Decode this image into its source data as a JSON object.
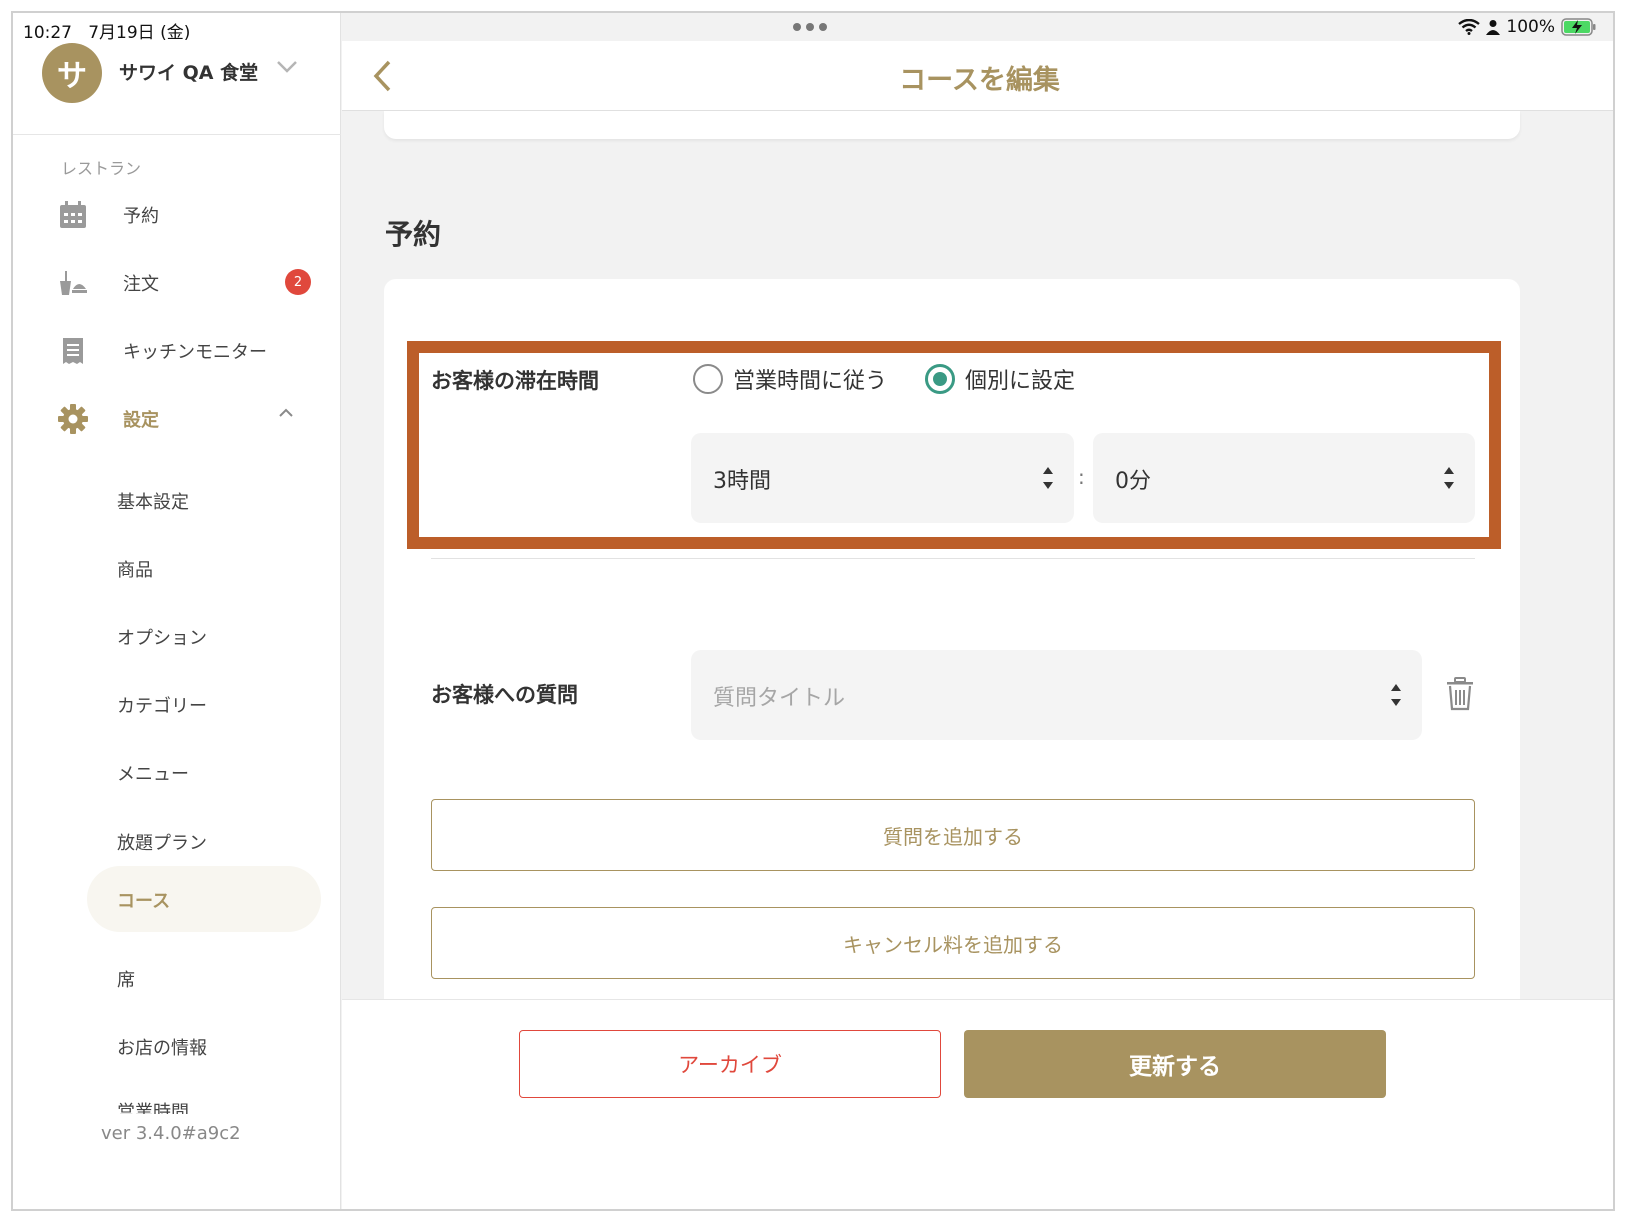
{
  "status_bar": {
    "time": "10:27",
    "date": "7月19日 (金)",
    "battery": "100%"
  },
  "sidebar": {
    "avatar_letter": "サ",
    "shop_name": "サワイ QA 食堂",
    "section_label": "レストラン",
    "nav": [
      {
        "label": "予約",
        "icon": "calendar-icon"
      },
      {
        "label": "注文",
        "icon": "order-icon",
        "badge": "2"
      },
      {
        "label": "キッチンモニター",
        "icon": "receipt-icon"
      },
      {
        "label": "設定",
        "icon": "gear-icon"
      }
    ],
    "settings_items": [
      "基本設定",
      "商品",
      "オプション",
      "カテゴリー",
      "メニュー",
      "放題プラン",
      "コース",
      "席",
      "お店の情報",
      "営業時間"
    ],
    "active_item": "コース",
    "version": "ver 3.4.0#a9c2"
  },
  "header": {
    "title": "コースを編集"
  },
  "main": {
    "section_title": "予約",
    "stay_time": {
      "label": "お客様の滞在時間",
      "option_follow": "営業時間に従う",
      "option_custom": "個別に設定",
      "selected": "個別に設定",
      "hours_value": "3時間",
      "separator": ":",
      "minutes_value": "0分"
    },
    "questions": {
      "label": "お客様への質問",
      "placeholder": "質問タイトル"
    },
    "add_question_button": "質問を追加する",
    "add_cancel_fee_button": "キャンセル料を追加する"
  },
  "footer": {
    "archive_button": "アーカイブ",
    "update_button": "更新する"
  },
  "colors": {
    "accent": "#a89360",
    "highlight_border": "#bc5e29",
    "danger": "#e0483c",
    "radio_selected": "#3a9a84"
  }
}
